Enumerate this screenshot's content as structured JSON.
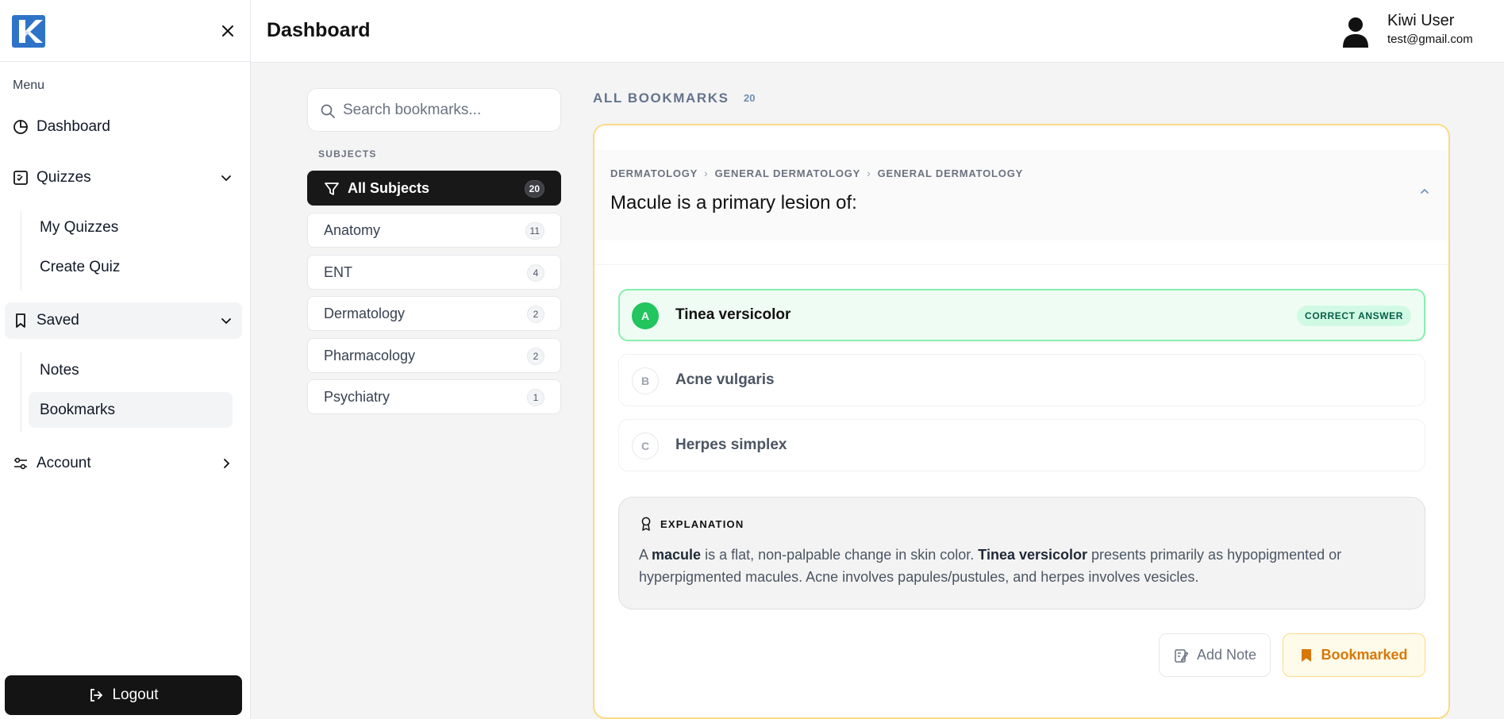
{
  "colors": {
    "accent": "#181818",
    "brand": "#2f73c8",
    "correct": "#22c55e",
    "bookmark": "#d97706",
    "card_border": "#fcd987"
  },
  "sidebar": {
    "logo": "K",
    "menu_label": "Menu",
    "items": {
      "dashboard": "Dashboard",
      "quizzes": "Quizzes",
      "my_quizzes": "My Quizzes",
      "create_quiz": "Create Quiz",
      "saved": "Saved",
      "notes": "Notes",
      "bookmarks": "Bookmarks",
      "account": "Account"
    },
    "logout": "Logout"
  },
  "header": {
    "title": "Dashboard",
    "user_name": "Kiwi User",
    "user_email": "test@gmail.com"
  },
  "search": {
    "placeholder": "Search bookmarks..."
  },
  "subjects": {
    "label": "SUBJECTS",
    "items": [
      {
        "name": "All Subjects",
        "count": "20"
      },
      {
        "name": "Anatomy",
        "count": "11"
      },
      {
        "name": "ENT",
        "count": "4"
      },
      {
        "name": "Dermatology",
        "count": "2"
      },
      {
        "name": "Pharmacology",
        "count": "2"
      },
      {
        "name": "Psychiatry",
        "count": "1"
      }
    ]
  },
  "bookmarks": {
    "title": "ALL BOOKMARKS",
    "count": "20",
    "card": {
      "breadcrumb": [
        "DERMATOLOGY",
        "GENERAL DERMATOLOGY",
        "GENERAL DERMATOLOGY"
      ],
      "question": "Macule is a primary lesion of:",
      "options": [
        {
          "letter": "A",
          "text": "Tinea versicolor",
          "correct": true
        },
        {
          "letter": "B",
          "text": "Acne vulgaris",
          "correct": false
        },
        {
          "letter": "C",
          "text": "Herpes simplex",
          "correct": false
        }
      ],
      "correct_badge": "CORRECT ANSWER",
      "explanation": {
        "title": "EXPLANATION",
        "t1": "A ",
        "b1": "macule",
        "t2": " is a flat, non-palpable change in skin color. ",
        "b2": "Tinea versicolor",
        "t3": " presents primarily as hypopigmented or hyperpigmented macules. Acne involves papules/pustules, and herpes involves vesicles."
      },
      "add_note": "Add Note",
      "bookmarked": "Bookmarked"
    }
  }
}
